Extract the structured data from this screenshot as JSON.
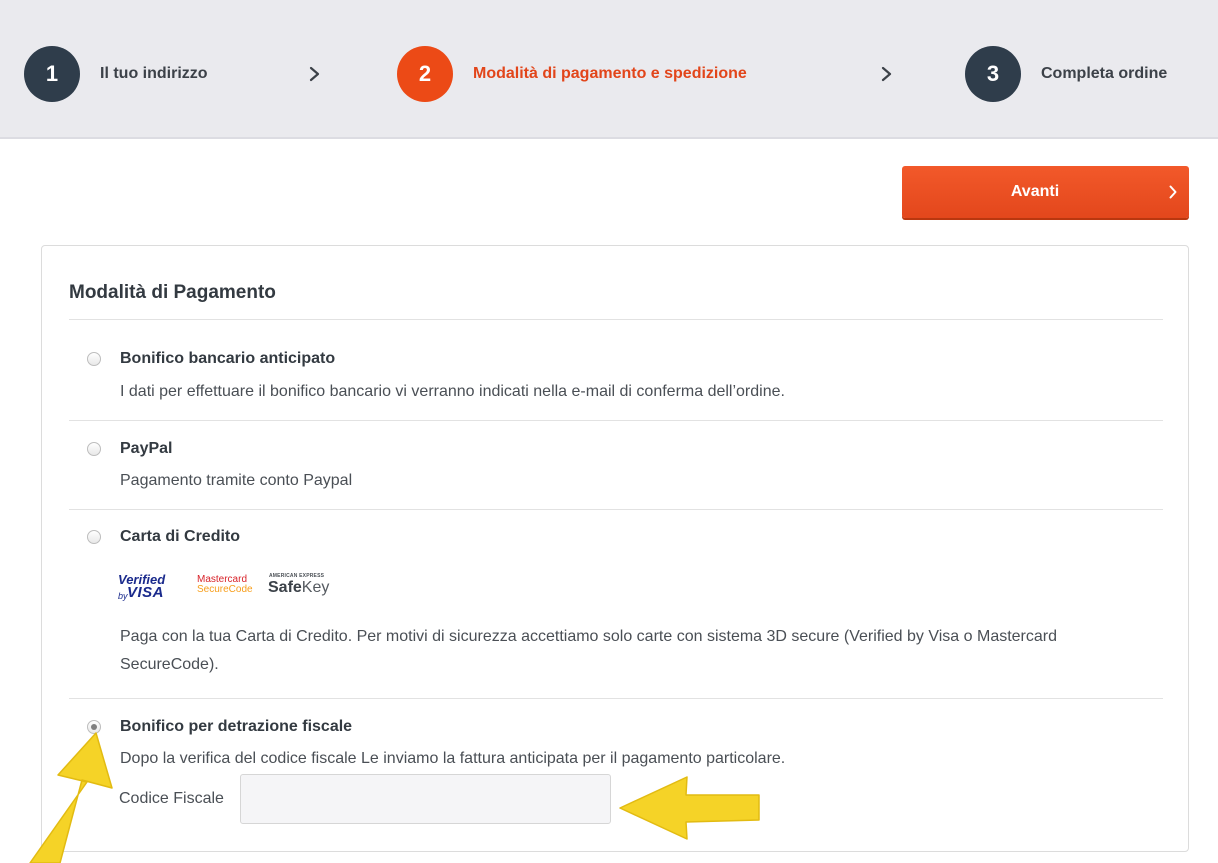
{
  "stepper": {
    "steps": [
      {
        "number": "1",
        "label": "Il tuo indirizzo",
        "state": "done"
      },
      {
        "number": "2",
        "label": "Modalità di pagamento e spedizione",
        "state": "active"
      },
      {
        "number": "3",
        "label": "Completa ordine",
        "state": "upcoming"
      }
    ]
  },
  "actions": {
    "next_label": "Avanti"
  },
  "payment": {
    "title": "Modalità di Pagamento",
    "options": [
      {
        "title": "Bonifico bancario anticipato",
        "description": "I dati per effettuare il bonifico bancario vi verranno indicati nella e-mail di conferma dell’ordine.",
        "selected": false
      },
      {
        "title": "PayPal",
        "description": "Pagamento tramite conto Paypal",
        "selected": false
      },
      {
        "title": "Carta di Credito",
        "description": "Paga con la tua Carta di Credito. Per motivi di sicurezza accettiamo solo carte con sistema 3D secure (Verified by Visa o Mastercard SecureCode).",
        "selected": false,
        "badges": {
          "verified_top": "Verified",
          "verified_by": "by",
          "verified_bottom": "VISA",
          "mc_top": "Mastercard",
          "mc_bottom": "SecureCode",
          "amex_top": "AMERICAN EXPRESS",
          "safe": "Safe",
          "key": "Key"
        }
      },
      {
        "title": "Bonifico per detrazione fiscale",
        "description": "Dopo la verifica del codice fiscale Le inviamo la fattura anticipata per il pagamento particolare.",
        "selected": true,
        "field": {
          "label": "Codice Fiscale",
          "value": "",
          "placeholder": ""
        }
      }
    ]
  },
  "colors": {
    "accent": "#ec4a16",
    "step_dark": "#2f3d4b",
    "stepper_bg": "#eaeaee",
    "annotation_arrow": "#f5d327"
  }
}
